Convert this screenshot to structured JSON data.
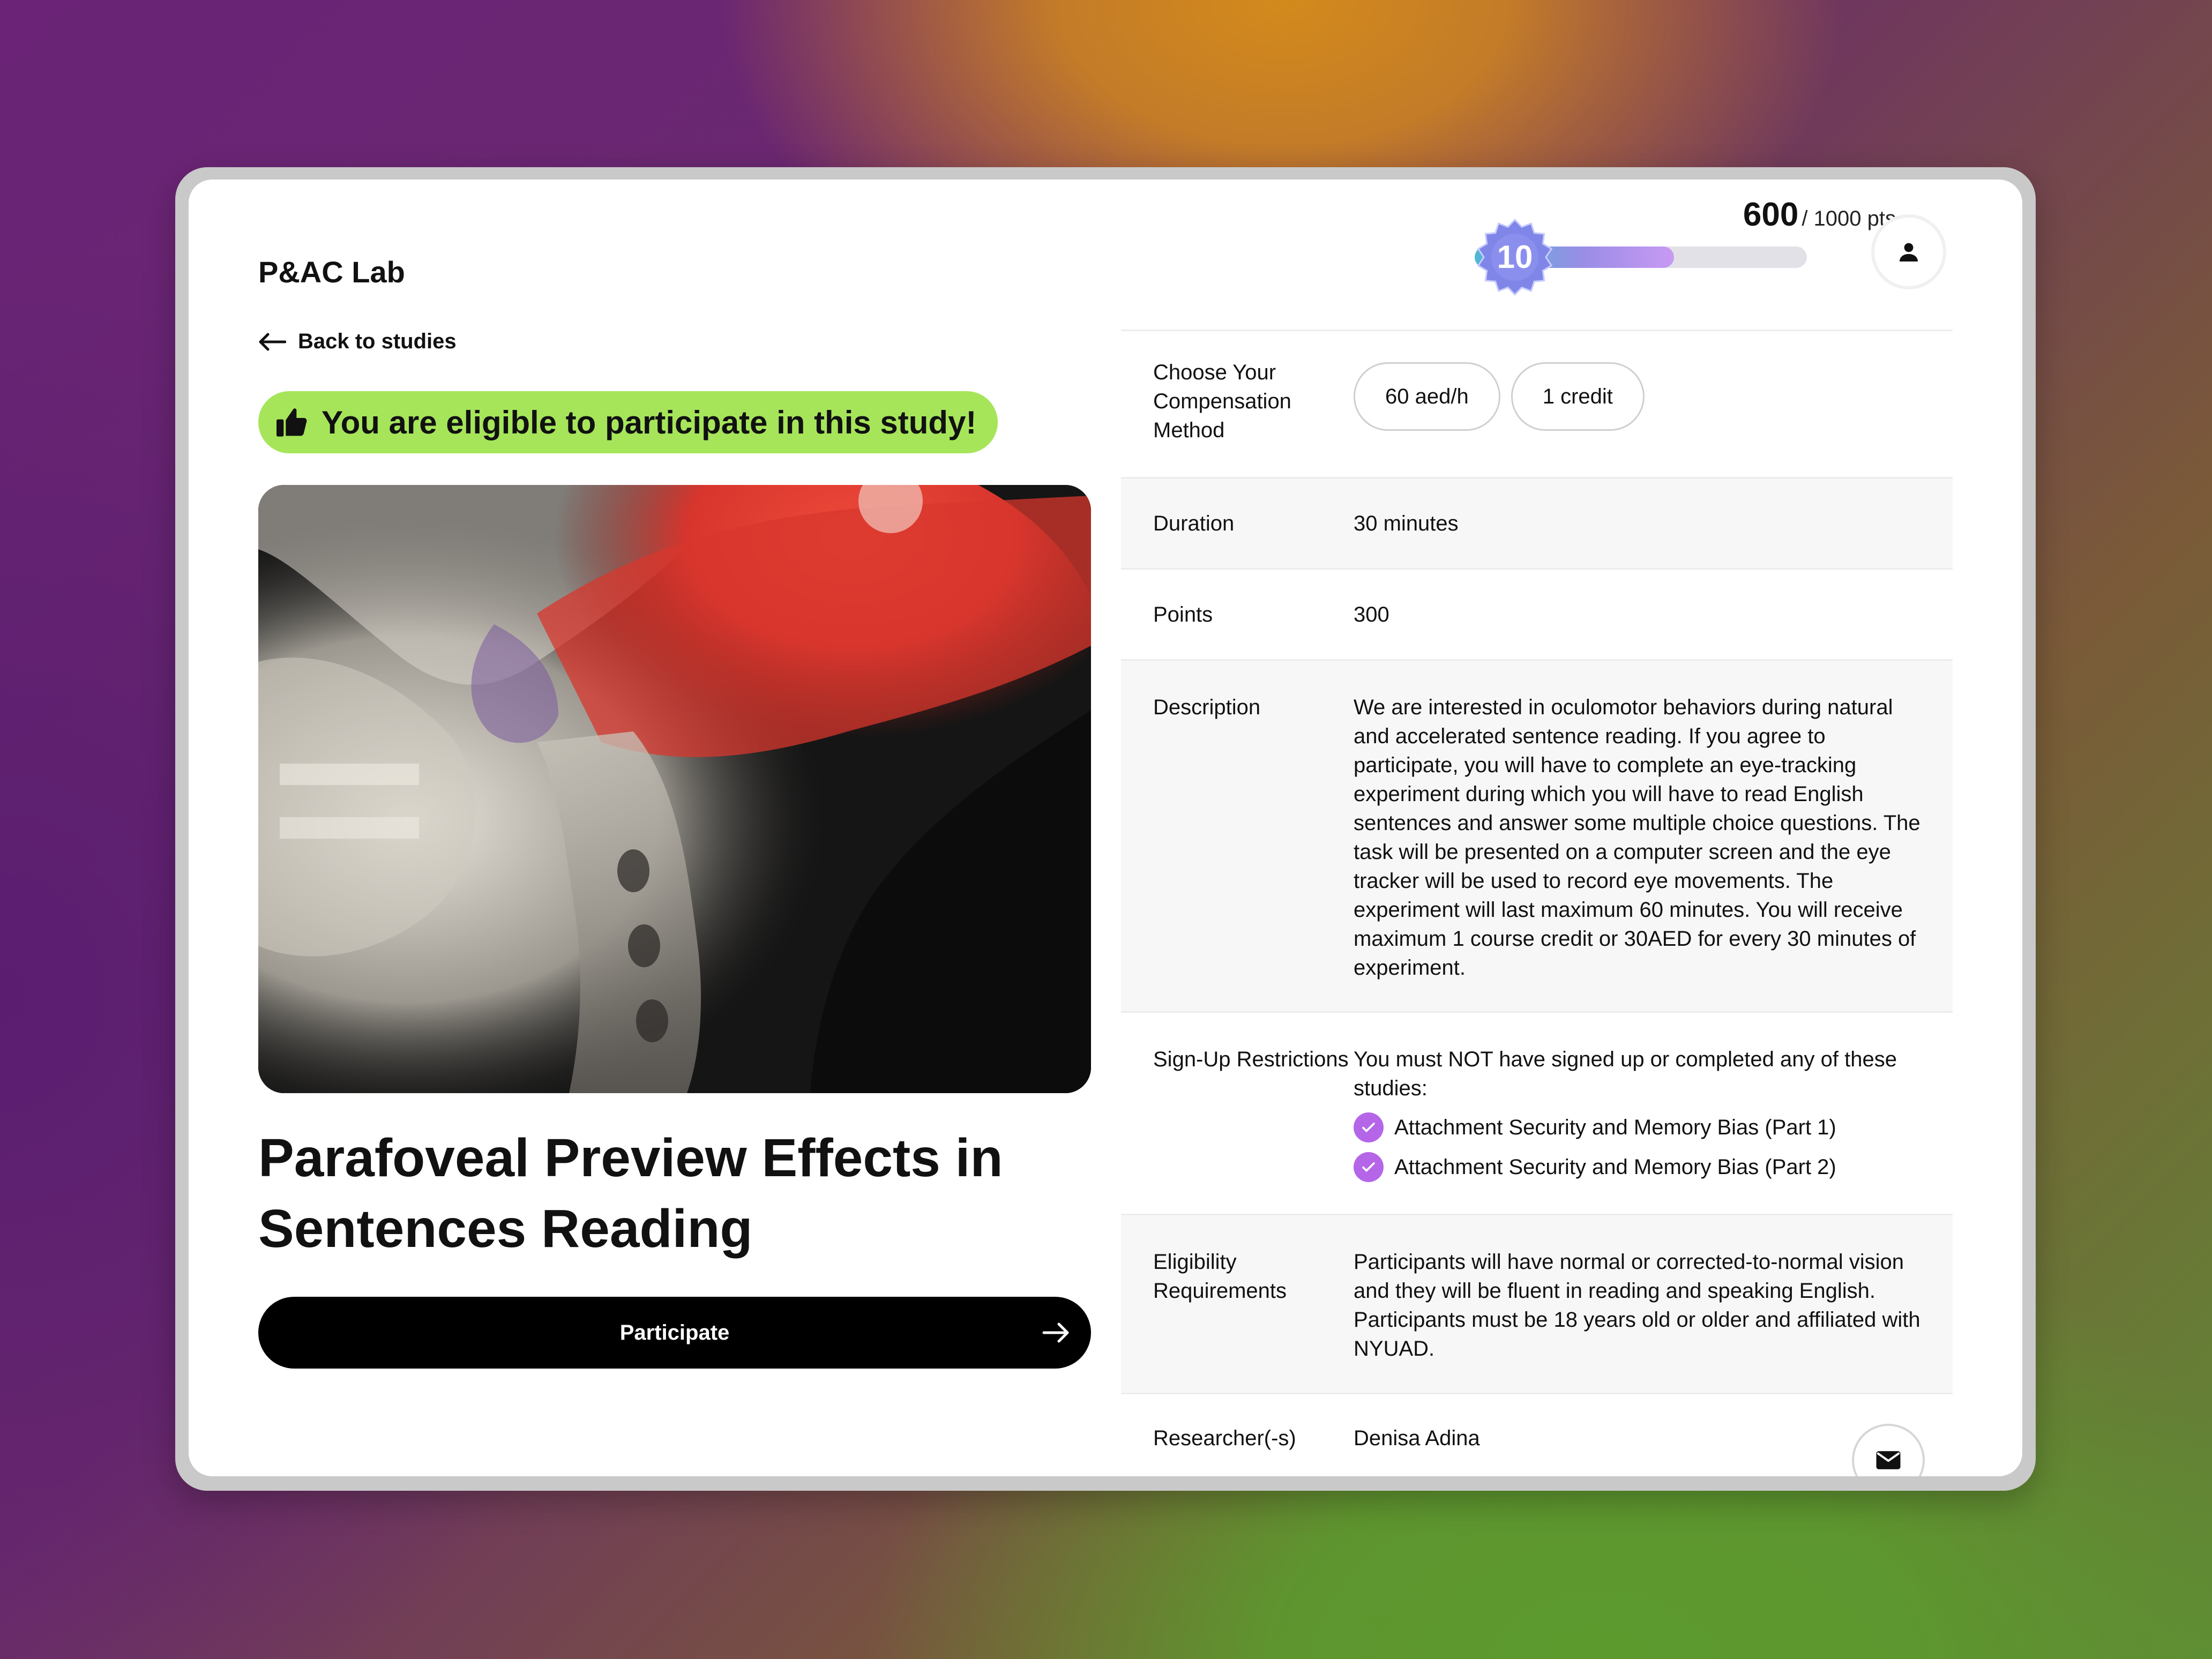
{
  "brand": "P&AC Lab",
  "points": {
    "current": "600",
    "total_label": "/ 1000 pts",
    "progress": 0.6,
    "level": "10"
  },
  "back_label": "Back to studies",
  "eligible_text": "You are eligible to participate in this study!",
  "study_title": "Parafoveal Preview Effects in Sentences Reading",
  "participate_label": "Participate",
  "details": {
    "compensation": {
      "label": "Choose Your Compensation Method",
      "options": [
        "60 aed/h",
        "1 credit"
      ]
    },
    "duration": {
      "label": "Duration",
      "value": "30 minutes"
    },
    "points": {
      "label": "Points",
      "value": "300"
    },
    "description": {
      "label": "Description",
      "value": "We are interested in oculomotor behaviors during natural and accelerated sentence reading. If you agree to participate, you will have to complete an eye-tracking experiment during which you will have to read English sentences and answer some multiple choice questions. The task will be presented on a computer screen and the eye tracker will be used to record eye movements. The experiment will last maximum 60 minutes. You will receive maximum 1 course credit or 30AED for every 30 minutes of experiment."
    },
    "restrictions": {
      "label": "Sign-Up Restrictions",
      "intro": "You must NOT have signed up or completed any of these studies:",
      "studies": [
        "Attachment Security and Memory Bias (Part 1)",
        "Attachment Security and Memory Bias (Part 2)"
      ]
    },
    "eligibility": {
      "label": "Eligibility Requirements",
      "value": "Participants will have normal or corrected-to-normal vision and they will be fluent in reading and speaking English. Participants must be 18 years old or older and affiliated with NYUAD."
    },
    "researchers": {
      "label": "Researcher(-s)",
      "value": "Denisa Adina"
    }
  },
  "icons": {
    "back": "arrow-left-icon",
    "thumb": "thumbs-up-icon",
    "user": "user-icon",
    "participate": "arrow-right-icon",
    "check": "check-icon",
    "mail": "mail-icon",
    "badge": "level-badge-icon"
  },
  "colors": {
    "eligible_bg": "#a6e55a",
    "check": "#b566e8",
    "progress_start": "#4fb7d6",
    "progress_end": "#c89af3",
    "badge": "#7f86e8"
  }
}
